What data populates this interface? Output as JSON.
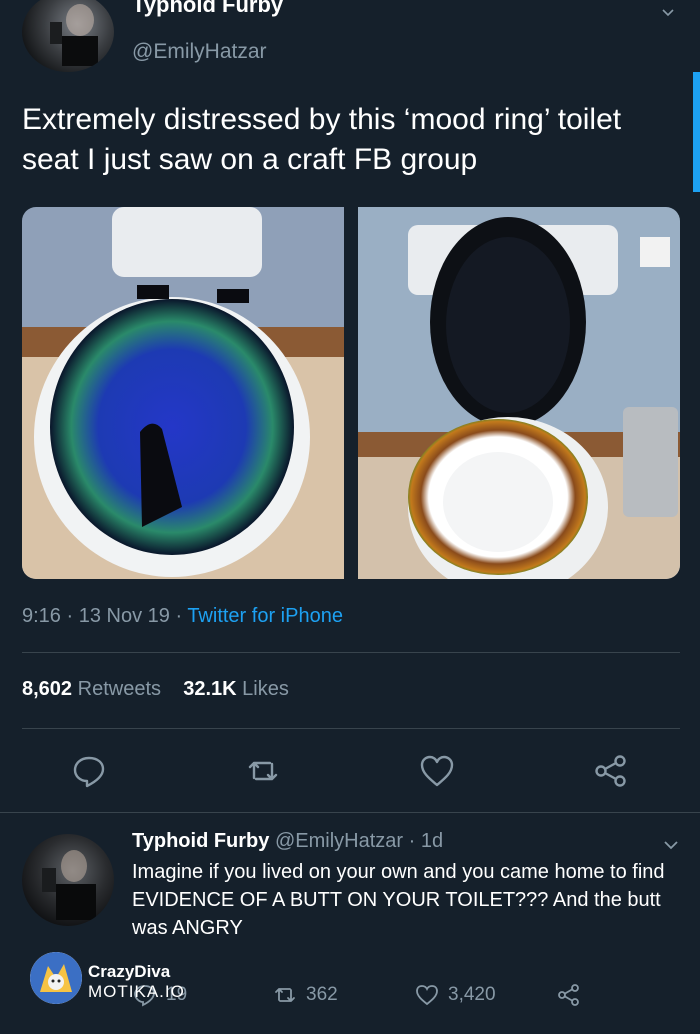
{
  "tweet": {
    "author_name": "Typhoid Furby",
    "author_handle": "@EmilyHatzar",
    "text": "Extremely distressed by this ‘mood ring’ toilet seat I just saw on a craft FB group",
    "time": "9:16",
    "date": "13 Nov 19",
    "source": "Twitter for iPhone",
    "retweet_count": "8,602",
    "retweet_label": "Retweets",
    "like_count": "32.1K",
    "like_label": "Likes"
  },
  "reply": {
    "author_name": "Typhoid Furby",
    "author_handle": "@EmilyHatzar",
    "time_ago": "1d",
    "text": "Imagine if you lived on your own and you came home to find EVIDENCE OF A BUTT ON YOUR TOILET??? And the butt was ANGRY",
    "reply_count": "19",
    "retweet_count": "362",
    "like_count": "3,420"
  },
  "watermark": {
    "name": "CrazyDiva",
    "domain": "MOTIKA.IO"
  },
  "colors": {
    "background": "#15202b",
    "secondary_text": "#8899a6",
    "accent": "#1da1f2",
    "divider": "#38444d"
  },
  "icons": [
    "chevron-down-icon",
    "reply-icon",
    "retweet-icon",
    "like-icon",
    "share-icon"
  ]
}
